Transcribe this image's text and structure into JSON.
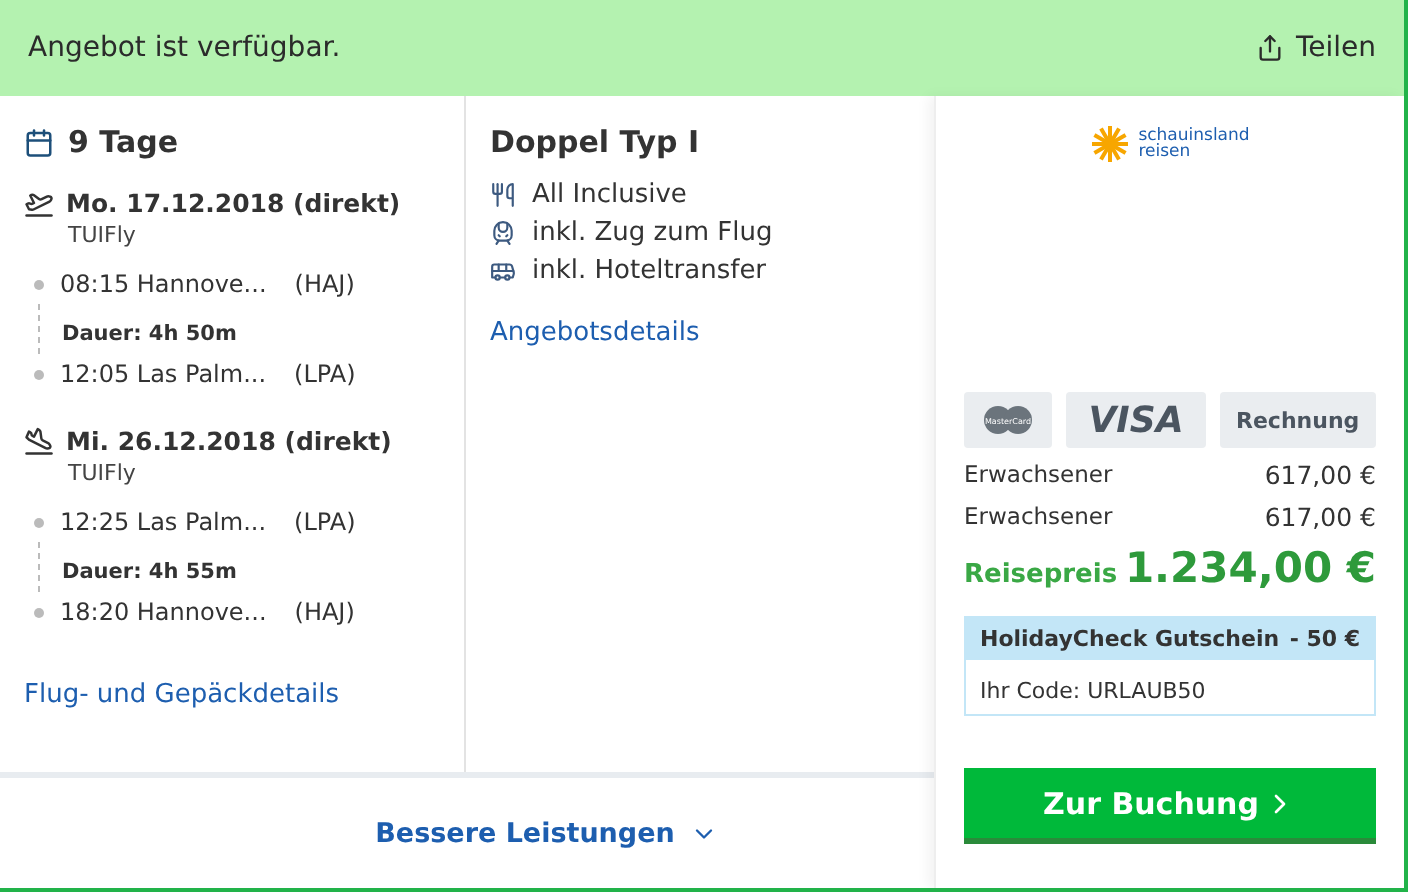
{
  "banner": {
    "message": "Angebot ist verfügbar.",
    "share_label": "Teilen"
  },
  "trip": {
    "duration": "9 Tage",
    "flights": [
      {
        "kind": "outbound",
        "date": "Mo. 17.12.2018 (direkt)",
        "airline": "TUIFly",
        "departure": {
          "time_place": "08:15 Hannove...",
          "code": "(HAJ)"
        },
        "duration": "Dauer: 4h 50m",
        "arrival": {
          "time_place": "12:05 Las Palm...",
          "code": "(LPA)"
        }
      },
      {
        "kind": "return",
        "date": "Mi. 26.12.2018 (direkt)",
        "airline": "TUIFly",
        "departure": {
          "time_place": "12:25 Las Palm...",
          "code": "(LPA)"
        },
        "duration": "Dauer: 4h 55m",
        "arrival": {
          "time_place": "18:20 Hannove...",
          "code": "(HAJ)"
        }
      }
    ],
    "details_link": "Flug- und Gepäckdetails"
  },
  "room": {
    "title": "Doppel Typ I",
    "features": [
      {
        "kind": "meal",
        "label": "All Inclusive"
      },
      {
        "kind": "train",
        "label": "inkl. Zug zum Flug"
      },
      {
        "kind": "bus",
        "label": "inkl. Hoteltransfer"
      }
    ],
    "details_link": "Angebotsdetails"
  },
  "operator": {
    "logo_line_1": "schauinsland",
    "logo_line_2": "reisen"
  },
  "payment_methods": [
    {
      "kind": "mastercard",
      "label": "MasterCard"
    },
    {
      "kind": "visa",
      "label": "VISA"
    },
    {
      "kind": "text",
      "label": "Rechnung"
    }
  ],
  "prices": [
    {
      "label": "Erwachsener",
      "amount": "617,00 €"
    },
    {
      "label": "Erwachsener",
      "amount": "617,00 €"
    }
  ],
  "total": {
    "label": "Reisepreis",
    "amount": "1.234,00 €"
  },
  "voucher": {
    "title": "HolidayCheck Gutschein",
    "discount": "- 50 €",
    "code": "Ihr Code: URLAUB50"
  },
  "more_link": "Bessere Leistungen",
  "book_button": "Zur Buchung"
}
